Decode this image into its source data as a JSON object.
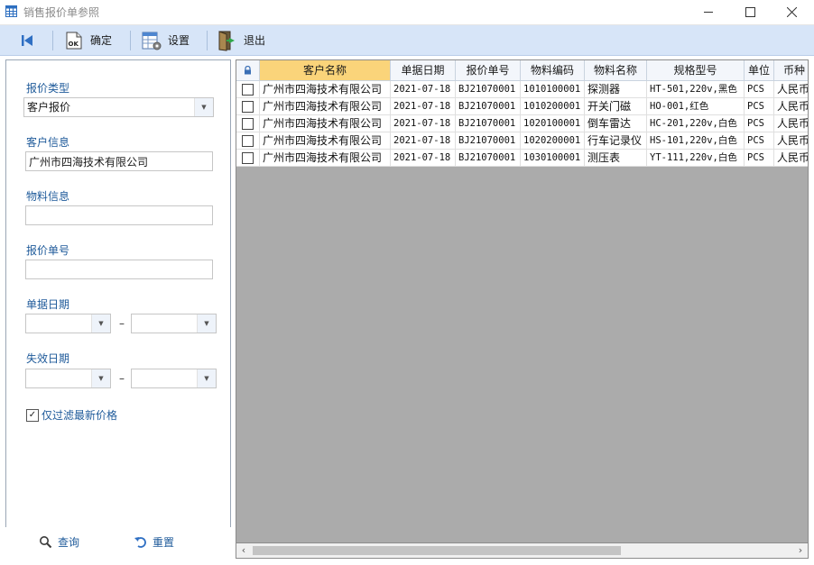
{
  "window": {
    "title": "销售报价单参照",
    "controls": [
      "minimize",
      "maximize",
      "close"
    ]
  },
  "toolbar": {
    "items": [
      {
        "icon": "first-record-icon",
        "label": ""
      },
      {
        "icon": "ok-icon",
        "label": "确定"
      },
      {
        "icon": "settings-table-icon",
        "label": "设置"
      },
      {
        "icon": "exit-door-icon",
        "label": "退出"
      }
    ]
  },
  "filters": {
    "quote_type": {
      "label": "报价类型",
      "value": "客户报价"
    },
    "customer": {
      "label": "客户信息",
      "value": "广州市四海技术有限公司"
    },
    "material": {
      "label": "物料信息",
      "value": ""
    },
    "quote_no": {
      "label": "报价单号",
      "value": ""
    },
    "doc_date": {
      "label": "单据日期",
      "from": "",
      "to": "",
      "separator": "–"
    },
    "expiry_date": {
      "label": "失效日期",
      "from": "",
      "to": "",
      "separator": "–"
    },
    "latest_only": {
      "label": "仅过滤最新价格",
      "checked": true,
      "mark": "✓"
    }
  },
  "actions": {
    "search_label": "查询",
    "reset_label": "重置"
  },
  "grid": {
    "lock_icon": "lock-icon",
    "columns": [
      "客户名称",
      "单据日期",
      "报价单号",
      "物料编码",
      "物料名称",
      "规格型号",
      "单位",
      "币种"
    ],
    "active_column": 0,
    "rows": [
      [
        "广州市四海技术有限公司",
        "2021-07-18",
        "BJ21070001",
        "1010100001",
        "探测器",
        "HT-501,220v,黑色",
        "PCS",
        "人民币"
      ],
      [
        "广州市四海技术有限公司",
        "2021-07-18",
        "BJ21070001",
        "1010200001",
        "开关门磁",
        "HO-001,红色",
        "PCS",
        "人民币"
      ],
      [
        "广州市四海技术有限公司",
        "2021-07-18",
        "BJ21070001",
        "1020100001",
        "倒车雷达",
        "HC-201,220v,白色",
        "PCS",
        "人民币"
      ],
      [
        "广州市四海技术有限公司",
        "2021-07-18",
        "BJ21070001",
        "1020200001",
        "行车记录仪",
        "HS-101,220v,白色",
        "PCS",
        "人民币"
      ],
      [
        "广州市四海技术有限公司",
        "2021-07-18",
        "BJ21070001",
        "1030100001",
        "测压表",
        "YT-111,220v,白色",
        "PCS",
        "人民币"
      ]
    ],
    "row_checked": [
      false,
      false,
      false,
      false,
      false
    ]
  },
  "colors": {
    "toolbar_bg": "#d7e5f8",
    "label_blue": "#1e5a9a",
    "active_header": "#fad47a",
    "grid_empty": "#ababab"
  }
}
